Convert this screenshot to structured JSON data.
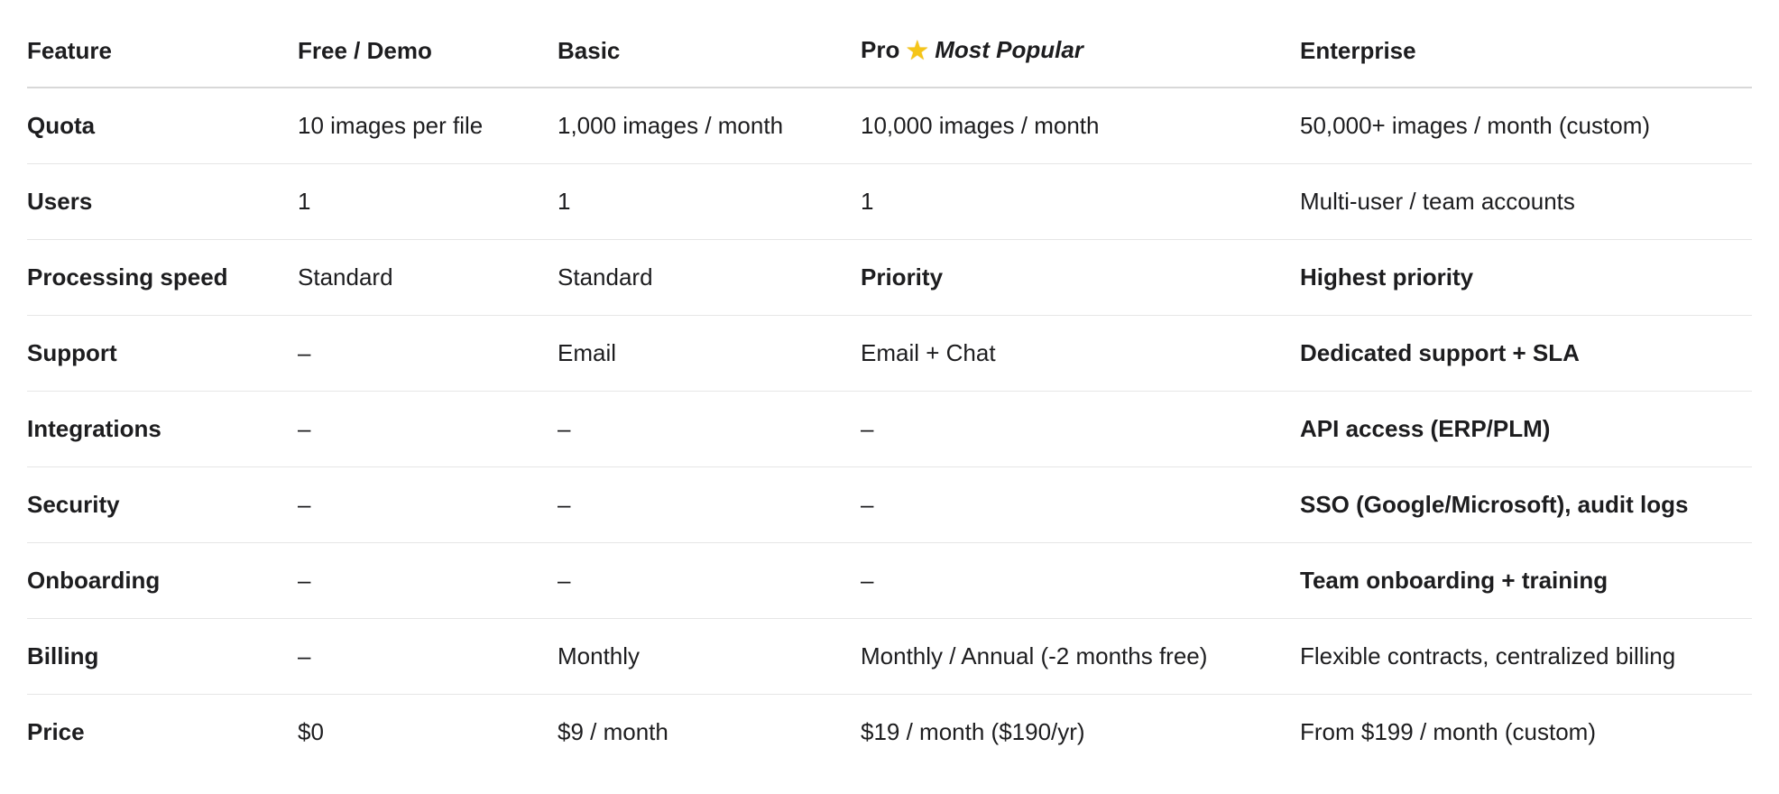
{
  "header": {
    "feature": "Feature",
    "free": "Free / Demo",
    "basic": "Basic",
    "pro": "Pro",
    "pro_star_icon": "star-icon",
    "pro_badge": "Most Popular",
    "enterprise": "Enterprise"
  },
  "rows": [
    {
      "feature": "Quota",
      "free": "10 images per file",
      "basic": "1,000 images / month",
      "pro": "10,000 images / month",
      "enterprise": "50,000+ images / month (custom)"
    },
    {
      "feature": "Users",
      "free": "1",
      "basic": "1",
      "pro": "1",
      "enterprise": "Multi-user / team accounts"
    },
    {
      "feature": "Processing speed",
      "free": "Standard",
      "basic": "Standard",
      "pro": "Priority",
      "enterprise": "Highest priority"
    },
    {
      "feature": "Support",
      "free": "–",
      "basic": "Email",
      "pro": "Email + Chat",
      "enterprise": "Dedicated support + SLA"
    },
    {
      "feature": "Integrations",
      "free": "–",
      "basic": "–",
      "pro": "–",
      "enterprise": "API access (ERP/PLM)"
    },
    {
      "feature": "Security",
      "free": "–",
      "basic": "–",
      "pro": "–",
      "enterprise": "SSO (Google/Microsoft), audit logs"
    },
    {
      "feature": "Onboarding",
      "free": "–",
      "basic": "–",
      "pro": "–",
      "enterprise": "Team onboarding + training"
    },
    {
      "feature": "Billing",
      "free": "–",
      "basic": "Monthly",
      "pro": "Monthly / Annual (-2 months free)",
      "enterprise": "Flexible contracts, centralized billing"
    },
    {
      "feature": "Price",
      "free": "$0",
      "basic": "$9 / month",
      "pro": "$19 / month ($190/yr)",
      "enterprise": "From $199 / month (custom)"
    }
  ]
}
